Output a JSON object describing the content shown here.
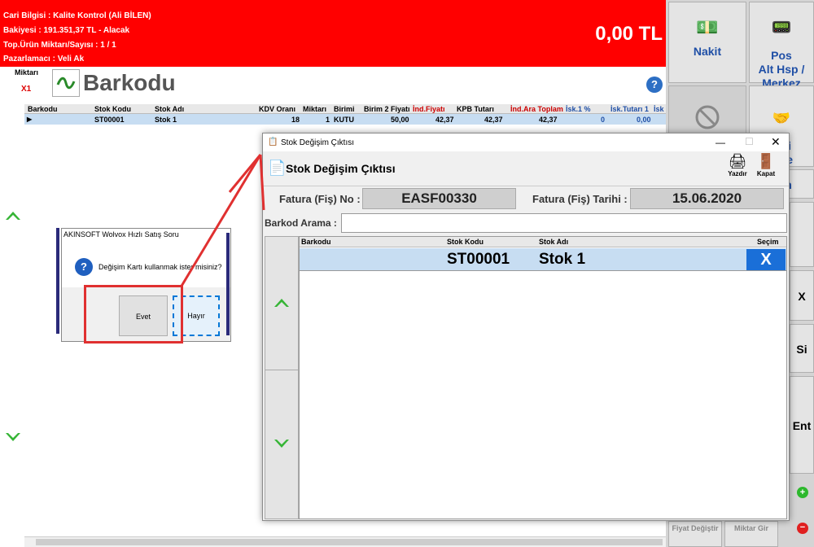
{
  "customer": {
    "info": "Cari Bilgisi : Kalite Kontrol (Ali BİLEN)",
    "balance": "Bakiyesi : 191.351,37 TL - Alacak",
    "total_qty": "Top.Ürün Miktarı/Sayısı : 1 / 1",
    "seller": "Pazarlamacı : Veli Ak"
  },
  "total_amount": "0,00 TL",
  "quantity_label": "Miktarı",
  "quantity_value": "X1",
  "barkodu_title": "Barkodu",
  "grid": {
    "headers": [
      "Barkodu",
      "Stok Kodu",
      "Stok Adı",
      "KDV Oranı",
      "Miktarı",
      "Birimi",
      "Birim 2 Fiyatı",
      "İnd.Fiyatı",
      "KPB Tutarı",
      "İnd.Ara Toplam",
      "İsk.1 %",
      "İsk.Tutarı 1",
      "İsk"
    ],
    "rows": [
      [
        "",
        "ST00001",
        "Stok 1",
        "18",
        "1",
        "KUTU",
        "50,00",
        "42,37",
        "42,37",
        "42,37",
        "0",
        "0,00",
        ""
      ]
    ]
  },
  "right_buttons": {
    "nakit": "Nakit",
    "pos": "Pos\nAlt Hsp /\nMerkez",
    "partial_1": "smi\neme",
    "partial_2": "irim",
    "partial_3": "X",
    "partial_4": "Si",
    "partial_5": "Ent",
    "bottom_1": "Fiyat Değiştir",
    "bottom_2": "Miktar Gir"
  },
  "stock_dialog": {
    "window_title": "Stok Değişim Çıktısı",
    "heading": "Stok Değişim Çıktısı",
    "print_label": "Yazdır",
    "close_label": "Kapat",
    "invoice_no_label": "Fatura (Fiş)  No :",
    "invoice_no": "EASF00330",
    "invoice_date_label": "Fatura (Fiş) Tarihi :",
    "invoice_date": "15.06.2020",
    "barcode_search_label": "Barkod Arama :",
    "barcode_search_value": "",
    "columns": [
      "Barkodu",
      "Stok Kodu",
      "Stok Adı",
      "Seçim"
    ],
    "rows": [
      {
        "barkodu": "",
        "stok_kodu": "ST00001",
        "stok_adi": "Stok 1",
        "secim": "X"
      }
    ]
  },
  "message_box": {
    "title": "AKINSOFT Wolvox Hızlı Satış Soru",
    "message": "Değişim Kartı kullanmak ister misiniz?",
    "yes": "Evet",
    "no": "Hayır"
  },
  "colors": {
    "header_red": "#ff0000",
    "selection_blue": "#c7ddf2",
    "accent_blue": "#1f4fa6",
    "annotation_red": "#e03030"
  }
}
